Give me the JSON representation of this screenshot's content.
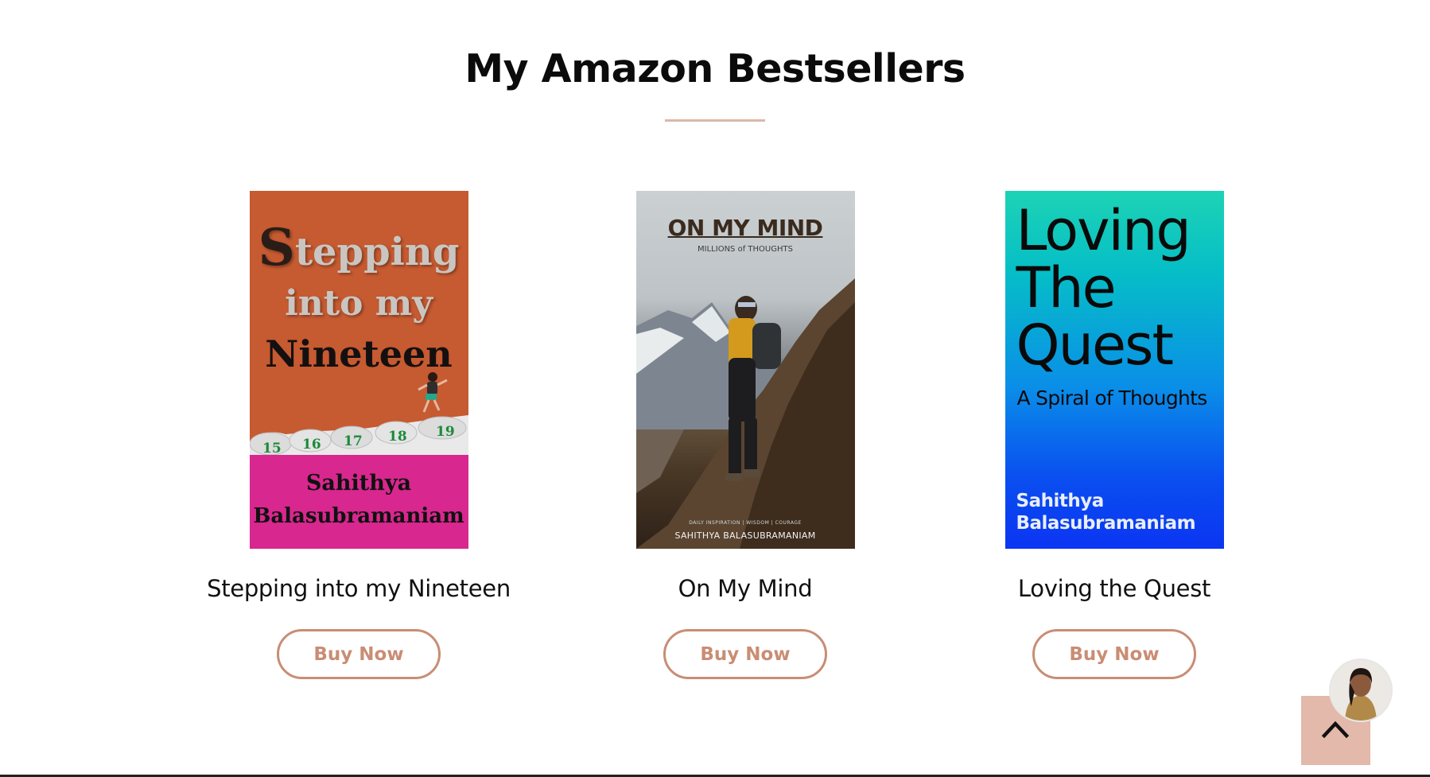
{
  "section": {
    "title": "My Amazon Bestsellers"
  },
  "books": [
    {
      "name": "Stepping into my Nineteen",
      "button_label": "Buy Now",
      "cover": {
        "title_cap": "S",
        "title_line1_rest": "tepping",
        "title_line2": "into my",
        "title_line3": "Nineteen",
        "numbers": [
          "15",
          "16",
          "17",
          "18",
          "19"
        ],
        "author_line1": "Sahithya",
        "author_line2": "Balasubramaniam",
        "colors": {
          "top": "#c65a31",
          "bottom": "#d8278e"
        }
      }
    },
    {
      "name": "On My Mind",
      "button_label": "Buy Now",
      "cover": {
        "title": "ON MY MIND",
        "subtitle": "MILLIONS of THOUGHTS",
        "tagline": "DAILY INSPIRATION | WISDOM | COURAGE",
        "author": "SAHITHYA BALASUBRAMANIAM"
      }
    },
    {
      "name": "Loving the Quest",
      "button_label": "Buy Now",
      "cover": {
        "title_line1": "Loving",
        "title_line2": "The",
        "title_line3": "Quest",
        "subtitle": "A Spiral of Thoughts",
        "author_line1": "Sahithya",
        "author_line2": "Balasubramaniam"
      }
    }
  ],
  "floating": {
    "scroll_top_icon": "chevron-up-icon",
    "avatar_icon": "author-avatar",
    "scroll_top_color": "#e2b9aa"
  },
  "colors": {
    "accent": "#c98d74",
    "underline": "#d9b9a8"
  }
}
